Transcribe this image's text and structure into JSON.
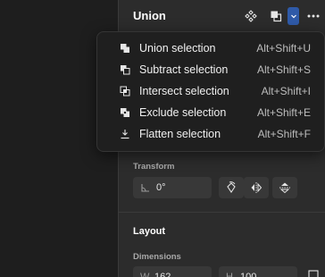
{
  "panel": {
    "title": "Union",
    "header_icons": [
      "component-icon",
      "boolean-ops-icon",
      "chevron-down-icon",
      "more-icon"
    ]
  },
  "menu": {
    "items": [
      {
        "label": "Union selection",
        "shortcut": "Alt+Shift+U",
        "icon": "union-icon"
      },
      {
        "label": "Subtract selection",
        "shortcut": "Alt+Shift+S",
        "icon": "subtract-icon"
      },
      {
        "label": "Intersect selection",
        "shortcut": "Alt+Shift+I",
        "icon": "intersect-icon"
      },
      {
        "label": "Exclude selection",
        "shortcut": "Alt+Shift+E",
        "icon": "exclude-icon"
      },
      {
        "label": "Flatten selection",
        "shortcut": "Alt+Shift+F",
        "icon": "flatten-icon"
      }
    ]
  },
  "transform": {
    "label": "Transform",
    "rotation": "0°"
  },
  "layout": {
    "title": "Layout",
    "dimensions_label": "Dimensions",
    "width_prefix": "W",
    "width_value": "162",
    "height_prefix": "H",
    "height_value": "100"
  },
  "colors": {
    "canvas": "#1e1e1e",
    "panel": "#2c2c2c",
    "accent": "#2f5aa8",
    "menu_bg": "#1f1f1f"
  }
}
